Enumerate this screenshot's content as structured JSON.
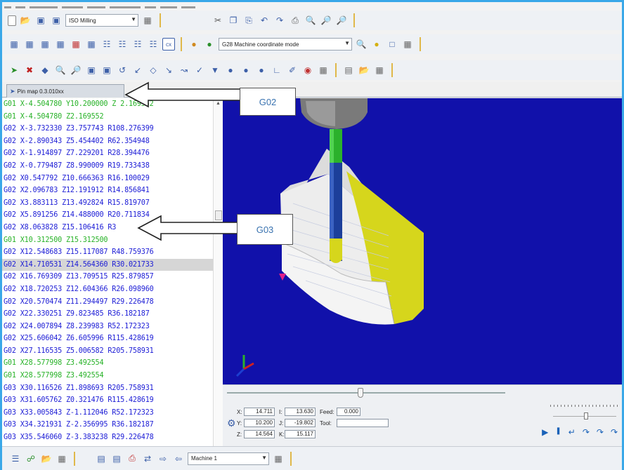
{
  "toolbar": {
    "format_combo": "ISO Milling",
    "mode_combo": "G28 Machine coordinate mode",
    "machine_combo": "Machine 1"
  },
  "tab": {
    "label": "Pin map 0.3.010xx"
  },
  "code_lines": [
    {
      "text": "G01 X-4.504780 Y10.200000 Z 2.169552",
      "kind": "g1"
    },
    {
      "text": "G01 X-4.504780 Z2.169552",
      "kind": "g1"
    },
    {
      "text": "G02 X-3.732330 Z3.757743 R108.276399",
      "kind": "g2"
    },
    {
      "text": "G02 X-2.890343 Z5.454402 R62.354948",
      "kind": "g2"
    },
    {
      "text": "G02 X-1.914897 Z7.229201 R28.394476",
      "kind": "g2"
    },
    {
      "text": "G02 X-0.779487 Z8.990009 R19.733438",
      "kind": "g2"
    },
    {
      "text": "G02 X0.547792 Z10.666363 R16.100029",
      "kind": "g2"
    },
    {
      "text": "G02 X2.096783 Z12.191912 R14.856841",
      "kind": "g2"
    },
    {
      "text": "G02 X3.883113 Z13.492824 R15.819707",
      "kind": "g2"
    },
    {
      "text": "G02 X5.891256 Z14.488000 R20.711834",
      "kind": "g2"
    },
    {
      "text": "G02 X8.063828 Z15.106416 R3",
      "kind": "g2"
    },
    {
      "text": "G01 X10.312500 Z15.312500",
      "kind": "g1"
    },
    {
      "text": "G02 X12.548683 Z15.117087 R48.759376",
      "kind": "g2"
    },
    {
      "text": "G02 X14.710531 Z14.564360 R30.021733",
      "kind": "sel"
    },
    {
      "text": "G02 X16.769309 Z13.709515 R25.879857",
      "kind": "g2"
    },
    {
      "text": "G02 X18.720253 Z12.604366 R26.098960",
      "kind": "g2"
    },
    {
      "text": "G02 X20.570474 Z11.294497 R29.226478",
      "kind": "g2"
    },
    {
      "text": "G02 X22.330251 Z9.823485 R36.182187",
      "kind": "g2"
    },
    {
      "text": "G02 X24.007894 Z8.239983 R52.172323",
      "kind": "g2"
    },
    {
      "text": "G02 X25.606042 Z6.605996 R115.428619",
      "kind": "g2"
    },
    {
      "text": "G02 X27.116535 Z5.006582 R205.758931",
      "kind": "g2"
    },
    {
      "text": "G01 X28.577998 Z3.492554",
      "kind": "g1"
    },
    {
      "text": "G01 X28.577998 Z3.492554",
      "kind": "g1"
    },
    {
      "text": "G03 X30.116526 Z1.898693 R205.758931",
      "kind": "g2"
    },
    {
      "text": "G03 X31.605762 Z0.321476 R115.428619",
      "kind": "g2"
    },
    {
      "text": "G03 X33.005843 Z-1.112046 R52.172323",
      "kind": "g2"
    },
    {
      "text": "G03 X34.321931 Z-2.356995 R36.182187",
      "kind": "g2"
    },
    {
      "text": "G03 X35.546060 Z-3.383238 R29.226478",
      "kind": "g2"
    }
  ],
  "coords": {
    "x_label": "X:",
    "x_value": "14.711",
    "y_label": "Y:",
    "y_value": "10.200",
    "z_label": "Z:",
    "z_value": "14.564",
    "i_label": "I:",
    "i_value": "13.630",
    "j_label": "J:",
    "j_value": "-19.802",
    "k_label": "K:",
    "k_value": "15.117",
    "feed_label": "Feed:",
    "feed_value": "0.000",
    "tool_label": "Tool:",
    "tool_value": ""
  },
  "callouts": {
    "top": "G02",
    "middle": "G03"
  },
  "colors": {
    "viewport_bg": "#1111aa",
    "g01_text": "#27b227",
    "g02_text": "#1d1dd6",
    "part_face": "#d6d61c",
    "tool_shank": "#1c3f9a",
    "tool_holder_green": "#2bb12b"
  }
}
